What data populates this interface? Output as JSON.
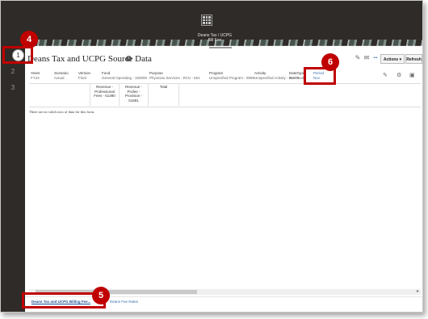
{
  "header": {
    "app_title_line1": "Deans Tax / UCPG",
    "app_title_line2": "Bill Fee"
  },
  "sidebar": {
    "items": [
      "1",
      "2",
      "3"
    ]
  },
  "form": {
    "title": "Deans Tax and UCPG Source Data",
    "info_symbol": "i"
  },
  "toolbar": {
    "more_label": "•••",
    "actions_label": "Actions ▾",
    "refresh_label": "Refresh"
  },
  "pov": [
    {
      "label": "Years",
      "value": "FY24"
    },
    {
      "label": "Scenario",
      "value": "Actual"
    },
    {
      "label": "Version",
      "value": "Final"
    },
    {
      "label": "Fund",
      "value": "General Operating - 100000"
    },
    {
      "label": "Purpose",
      "value": "Physician Services - RVU - 651"
    },
    {
      "label": "Program",
      "value": "Unspecified Program - 9999"
    },
    {
      "label": "Activity",
      "value": "Unspecified Activity - 99999"
    },
    {
      "label": "DataType",
      "value": "GL Fixed"
    },
    {
      "label": "Period",
      "value": "Nov"
    }
  ],
  "columns": [
    {
      "line1": "Revenue -",
      "line2": "Professional",
      "line3": "Fees - 51390"
    },
    {
      "line1": "Revenue -",
      "line2": "Profee -",
      "line3": "Provision -",
      "line4": "51681"
    },
    {
      "line1": "Total"
    }
  ],
  "messages": {
    "no_data": "There are no valid rows of data for this form."
  },
  "tabs": [
    {
      "label": "Deans Tax and UCPG Billing Fee..."
    },
    {
      "label": "Deans Fee Rates"
    }
  ],
  "annotations": {
    "badge4": "4",
    "badge5": "5",
    "badge6": "6"
  },
  "colors": {
    "highlight": "#c00000",
    "chrome": "#2f2b28",
    "link": "#3a6fb0"
  }
}
